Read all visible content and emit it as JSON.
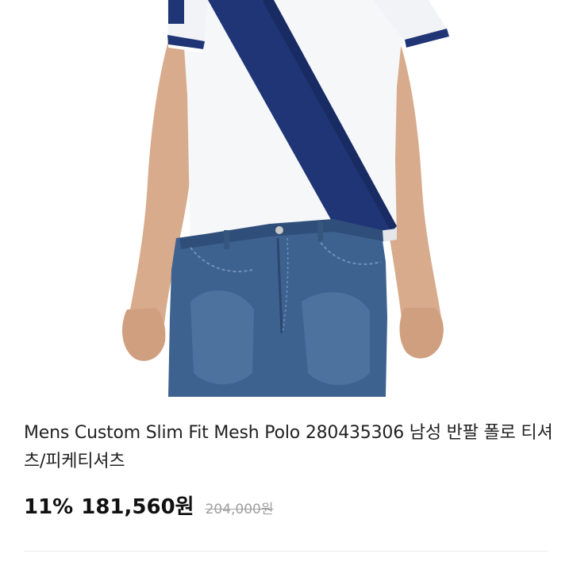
{
  "product": {
    "image_alt": "Mens Custom Slim Fit Mesh Polo",
    "title": "Mens Custom Slim Fit Mesh Polo 280435306 남성 반팔 폴로 티셔츠/피케티셔츠"
  },
  "pricing": {
    "discount": "11%",
    "sale_price": "181,560원",
    "original_price": "204,000원"
  },
  "colors": {
    "shirt": "#f7f8fa",
    "stripe": "#1f3576",
    "denim": "#3d5f8a",
    "skin": "#d6a98a",
    "text": "#222222",
    "muted": "#a0a0a0"
  }
}
